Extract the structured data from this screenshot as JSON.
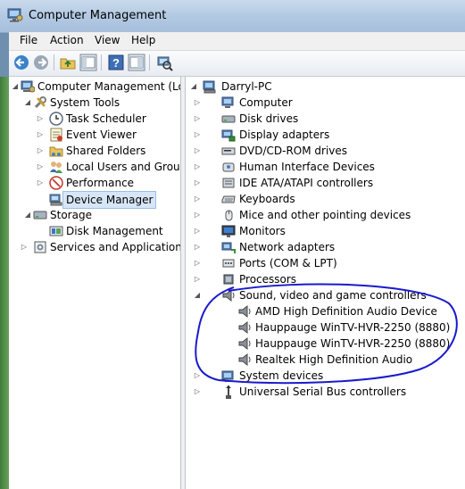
{
  "window": {
    "title": "Computer Management"
  },
  "menu": {
    "items": [
      "File",
      "Action",
      "View",
      "Help"
    ]
  },
  "toolbar": {
    "buttons": [
      "back-icon",
      "forward-icon",
      "up-folder-icon",
      "show-hide-tree-icon",
      "help-icon",
      "properties-icon",
      "scan-hardware-icon"
    ]
  },
  "left_tree": {
    "items": [
      {
        "label": "Computer Management (Local",
        "icon": "computer-management-icon",
        "expander": "down"
      },
      {
        "label": "System Tools",
        "icon": "tools-icon",
        "expander": "down"
      },
      {
        "label": "Task Scheduler",
        "icon": "clock-icon",
        "expander": "right"
      },
      {
        "label": "Event Viewer",
        "icon": "event-viewer-icon",
        "expander": "right"
      },
      {
        "label": "Shared Folders",
        "icon": "shared-folder-icon",
        "expander": "right"
      },
      {
        "label": "Local Users and Groups",
        "icon": "users-icon",
        "expander": "right"
      },
      {
        "label": "Performance",
        "icon": "performance-icon",
        "expander": "right"
      },
      {
        "label": "Device Manager",
        "icon": "device-manager-icon",
        "expander": "none",
        "selected": true
      },
      {
        "label": "Storage",
        "icon": "storage-icon",
        "expander": "down"
      },
      {
        "label": "Disk Management",
        "icon": "disk-management-icon",
        "expander": "none"
      },
      {
        "label": "Services and Applications",
        "icon": "services-icon",
        "expander": "right"
      }
    ]
  },
  "device_tree": {
    "root": "Darryl-PC",
    "items": [
      {
        "label": "Computer",
        "icon": "computer-icon",
        "expander": "right"
      },
      {
        "label": "Disk drives",
        "icon": "disk-drive-icon",
        "expander": "right"
      },
      {
        "label": "Display adapters",
        "icon": "display-adapter-icon",
        "expander": "right"
      },
      {
        "label": "DVD/CD-ROM drives",
        "icon": "dvd-icon",
        "expander": "right"
      },
      {
        "label": "Human Interface Devices",
        "icon": "hid-icon",
        "expander": "right"
      },
      {
        "label": "IDE ATA/ATAPI controllers",
        "icon": "ide-icon",
        "expander": "right"
      },
      {
        "label": "Keyboards",
        "icon": "keyboard-icon",
        "expander": "right"
      },
      {
        "label": "Mice and other pointing devices",
        "icon": "mouse-icon",
        "expander": "right"
      },
      {
        "label": "Monitors",
        "icon": "monitor-icon",
        "expander": "right"
      },
      {
        "label": "Network adapters",
        "icon": "network-adapter-icon",
        "expander": "right"
      },
      {
        "label": "Ports (COM & LPT)",
        "icon": "port-icon",
        "expander": "right"
      },
      {
        "label": "Processors",
        "icon": "processor-icon",
        "expander": "right"
      },
      {
        "label": "Sound, video and game controllers",
        "icon": "speaker-icon",
        "expander": "down"
      },
      {
        "label": "AMD High Definition Audio Device",
        "icon": "speaker-icon",
        "expander": "none",
        "child": true
      },
      {
        "label": "Hauppauge WinTV-HVR-2250 (8880)",
        "icon": "speaker-icon",
        "expander": "none",
        "child": true
      },
      {
        "label": "Hauppauge WinTV-HVR-2250 (8880)",
        "icon": "speaker-icon",
        "expander": "none",
        "child": true
      },
      {
        "label": "Realtek High Definition Audio",
        "icon": "speaker-icon",
        "expander": "none",
        "child": true
      },
      {
        "label": "System devices",
        "icon": "system-device-icon",
        "expander": "right"
      },
      {
        "label": "Universal Serial Bus controllers",
        "icon": "usb-icon",
        "expander": "right"
      }
    ]
  },
  "colors": {
    "annotation": "#1a1acc",
    "selection": "#d7e6f7",
    "titlebar": "#b9cde5"
  }
}
